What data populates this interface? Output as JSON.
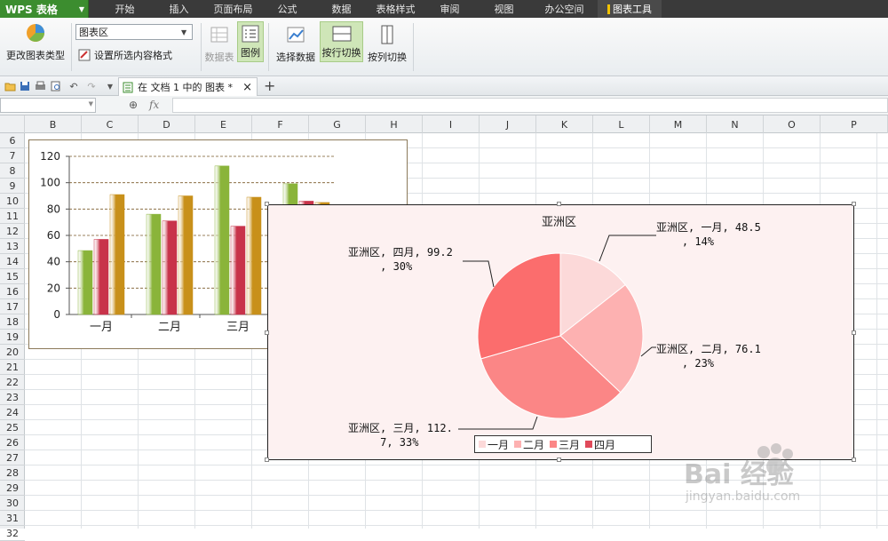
{
  "app": {
    "logo": "WPS 表格"
  },
  "menu": [
    "开始",
    "插入",
    "页面布局",
    "公式",
    "数据",
    "表格样式",
    "审阅",
    "视图",
    "办公空间",
    "图表工具"
  ],
  "ribbon": {
    "change_type": "更改图表类型",
    "chart_area_value": "图表区",
    "format_selection": "设置所选内容格式",
    "data_table": "数据表",
    "legend": "图例",
    "select_data": "选择数据",
    "switch_row": "按行切换",
    "switch_col": "按列切换"
  },
  "tab": {
    "doc_label": "在 文档 1 中的 图表 *",
    "close": "×",
    "add": "+"
  },
  "formula": {
    "fx": "fx"
  },
  "columns": [
    "B",
    "C",
    "D",
    "E",
    "F",
    "G",
    "H",
    "I",
    "J",
    "K",
    "L",
    "M",
    "N",
    "O",
    "P"
  ],
  "rows": [
    "6",
    "7",
    "8",
    "9",
    "10",
    "11",
    "12",
    "13",
    "14",
    "15",
    "16",
    "17",
    "18",
    "19",
    "20",
    "21",
    "22",
    "23",
    "24",
    "25",
    "26",
    "27",
    "28",
    "29",
    "30",
    "31",
    "32"
  ],
  "chart_data": [
    {
      "type": "bar",
      "categories": [
        "一月",
        "二月",
        "三月",
        "四月"
      ],
      "series": [
        {
          "values": [
            48.5,
            76.1,
            112.7,
            99.2
          ],
          "color": "#8ab43a"
        },
        {
          "values": [
            57,
            71,
            67,
            86
          ],
          "color": "#c8334a"
        },
        {
          "values": [
            91,
            90,
            89,
            85
          ],
          "color": "#c8901a"
        }
      ],
      "yticks": [
        "0",
        "20",
        "40",
        "60",
        "80",
        "100",
        "120"
      ],
      "ylim": [
        0,
        120
      ],
      "grid": true
    },
    {
      "type": "pie",
      "title": "亚洲区",
      "categories": [
        "一月",
        "二月",
        "三月",
        "四月"
      ],
      "values": [
        48.5,
        76.1,
        112.7,
        99.2
      ],
      "colors": [
        "#fcd9d9",
        "#fdb1b1",
        "#fb8686",
        "#fb6d6d"
      ],
      "labels": [
        "亚洲区, 一月, 48.5\n    , 14%",
        "亚洲区, 二月, 76.1\n    , 23%",
        "亚洲区, 三月, 112.\n     7, 33%",
        "亚洲区, 四月, 99.2\n     , 30%"
      ],
      "legend": "bottom"
    }
  ],
  "watermark": {
    "text": "jingyan.baidu.com",
    "brand": "Bai 经验"
  }
}
